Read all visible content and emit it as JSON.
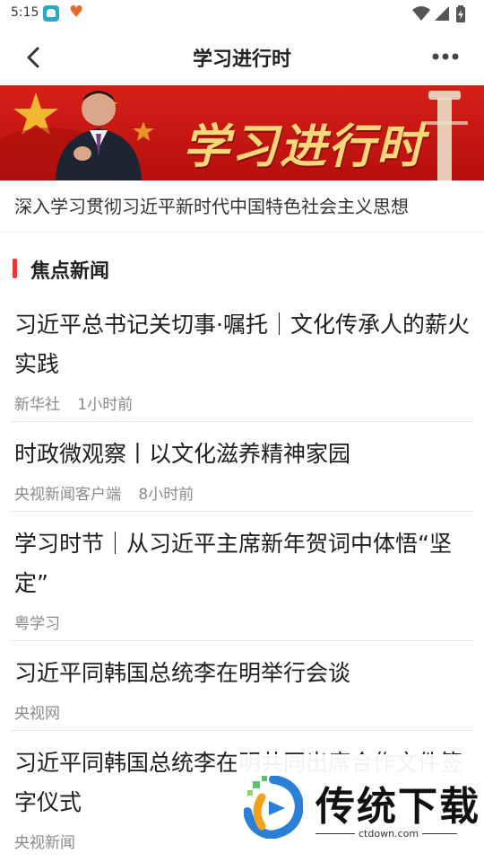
{
  "status_bar": {
    "time": "5:15"
  },
  "nav": {
    "title": "学习进行时"
  },
  "banner": {
    "text": "学习进行时"
  },
  "subtitle": "深入学习贯彻习近平新时代中国特色社会主义思想",
  "section": {
    "title": "焦点新闻",
    "accent_color": "#e53a35"
  },
  "news": [
    {
      "headline": "习近平总书记关切事·嘱托｜文化传承人的薪火实践",
      "source": "新华社",
      "time": "1小时前"
    },
    {
      "headline": "时政微观察丨以文化滋养精神家园",
      "source": "央视新闻客户端",
      "time": "8小时前"
    },
    {
      "headline": "学习时节｜从习近平主席新年贺词中体悟“坚定”",
      "source": "粤学习",
      "time": ""
    },
    {
      "headline": "习近平同韩国总统李在明举行会谈",
      "source": "央视网",
      "time": ""
    },
    {
      "headline": "习近平同韩国总统李在明共同出席合作文件签字仪式",
      "source": "央视新闻",
      "time": ""
    }
  ],
  "watermark": {
    "brand": "传统下载",
    "url": "ctdown.com"
  }
}
